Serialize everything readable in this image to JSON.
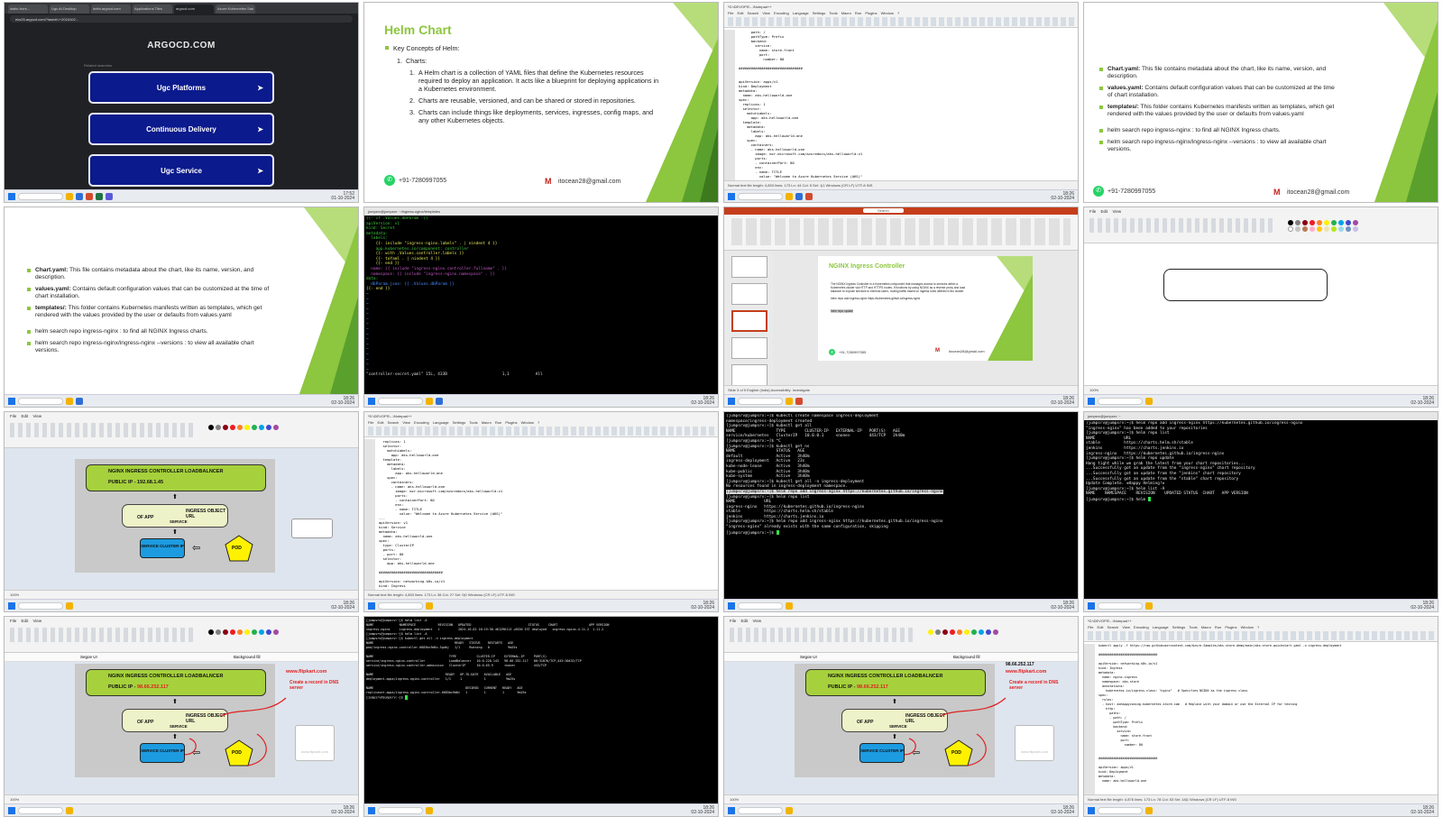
{
  "accent": "#8dc63f",
  "tiles": {
    "t1": {
      "tabs": [
        "static-front...",
        "Ugc At Desktop",
        "delta.argocd.com",
        "Applications Tiles",
        "argocd.com",
        "Azure Kubernetes Sab"
      ],
      "url": "eks25.argocd.com/?lastvtf=+2024102...",
      "logo": "ARGOCD.COM",
      "sub": "Related searches",
      "buttons": [
        "Ugc Platforms",
        "Continuous Delivery",
        "Ugc Service"
      ],
      "clock": [
        "17:52",
        "01-10-2024"
      ]
    },
    "t2": {
      "title": "Helm Chart",
      "bullet1": "Key Concepts of Helm:",
      "n1": "Charts:",
      "items": [
        "A Helm chart is a collection of YAML files that define the Kubernetes resources required to deploy an application. It acts like a blueprint for deploying applications in a Kubernetes environment.",
        "Charts are reusable, versioned, and can be shared or stored in repositories.",
        "Charts can include things like deployments, services, ingresses, config maps, and any other Kubernetes objects."
      ],
      "phone": "+91-7280997055",
      "email": "itocean28@gmail.com"
    },
    "t3": {
      "title": "*D:\\DEVOPS\\...\\Notepad++",
      "menu": "File Edit Search View Encoding Language Settings Tools Macro Run Plugins Window ?",
      "code": "      path: /\n      pathType: Prefix\n      backend:\n        service:\n          name: store-front\n          port:\n            number: 80\n\n###############################\n\n\napiVersion: apps/v1\nkind: Deployment\nmetadata:\n  name: aks-helloworld-one\nspec:\n  replicas: 1\n  selector:\n    matchLabels:\n      app: aks-helloworld-one\n  template:\n    metadata:\n      labels:\n        app: aks-helloworld-one\n    spec:\n      containers:\n      - name: aks-helloworld-one\n        image: mcr.microsoft.com/azuredocs/aks-helloworld:v1\n        ports:\n        - containerPort: 80\n        env:\n        - name: TITLE\n          value: \"Welcome to Azure Kubernetes Service (AKS)\"",
      "status": "Normal text file     length: 4,853  lines: 173     Ln: 44  Col: 5  Sel: 1|1     Windows (CR LF)  UTF-8  INS"
    },
    "t4": {
      "items": [
        [
          "Chart.yaml:",
          " This file contains metadata about the chart, like its name, version, and description."
        ],
        [
          "values.yaml:",
          " Contains default configuration values that can be customized at the time of chart installation."
        ],
        [
          "templates/:",
          " This folder contains Kubernetes manifests written as templates, which get rendered with the values provided by the user or defaults from values.yaml"
        ]
      ],
      "cmds": [
        "helm search repo ingress-nginx : to find all NGINX Ingress charts.",
        "helm search repo ingress-nginx/ingress-nginx --versions : to view all available chart versions."
      ],
      "phone": "+91-7280997055",
      "email": "itocean28@gmail.com"
    },
    "t6": {
      "lines": [
        "{{- if .Values.dbParam -}}",
        "apiVersion: v1",
        "kind: Secret",
        "metadata:",
        "  labels:",
        "    {{- include \"ingress-nginx.labels\" . | nindent 4 }}",
        "    app.kubernetes.io/component: controller",
        "    {{- with .Values.controller.labels }}",
        "    {{- toYaml . | nindent 4 }}",
        "    {{- end }}",
        "  name: {{ include \"ingress-nginx.controller.fullname\" . }}",
        "  namespace: {{ include \"ingress-nginx.namespace\" . }}",
        "data:",
        "  dbParam.json: {{ .Values.dbParam }}",
        "{{- end }}"
      ],
      "status": "\"controller-secret.yaml\" 15L, 433B",
      "pos": "1,1",
      "all": "All"
    },
    "t7": {
      "search": "Search",
      "title": "NGINX Ingress Controller",
      "body": "The NGINX Ingress Controller is a Kubernetes component that manages access to services within a Kubernetes cluster via HTTP and HTTPS routes. It functions by using NGINX as a reverse proxy and load balancer to expose services to external users, routing traffic based on ingress rules defined in the cluster.",
      "cmd1": "helm repo add ingress-nginx https://kubernetes.github.io/ingress-nginx",
      "cmd2": "helm repo update",
      "phone": "+91-7280997055",
      "email": "itocean28@gmail.com",
      "status": "Slide 3 of 5   English (India)   Accessibility: Investigate"
    },
    "t8": {
      "menu": "File  Edit  View",
      "status": "100%"
    },
    "t9": {
      "menu": "File  Edit  View",
      "lb": "NGINX INGRESS CONTROLLER LOADBALNCER",
      "ip": "PUBLIC IP - 192.68.1.45",
      "obj": "INGRESS OBJECT URL",
      "ofapp": "OF APP",
      "service": "SERVICE",
      "svc": "SERVICE CLUSTER IP",
      "pod": "POD",
      "status": "100%"
    },
    "t10": {
      "title": "*D:\\DEVOPS\\...\\Notepad++",
      "code": "  replicas: 1\n  selector:\n    matchLabels:\n      app: aks-helloworld-one\n  template:\n    metadata:\n      labels:\n        app: aks-helloworld-one\n    spec:\n      containers:\n      - name: aks-helloworld-one\n        image: mcr.microsoft.com/azuredocs/aks-helloworld:v1\n        ports:\n        - containerPort: 80\n        env:\n        - name: TITLE\n          value: \"Welcome to Azure Kubernetes Service (AKS)\"\n---\napiVersion: v1\nkind: Service\nmetadata:\n  name: aks-helloworld-one\nspec:\n  type: ClusterIP\n  ports:\n  - port: 80\n  selector:\n    app: aks-helloworld-one\n\n###############################\n\napiVersion: networking.k8s.io/v1\nkind: Ingress\nmetadata:",
      "status": "Normal text file     length: 4,853  lines: 173     Ln: 38  Col: 27  Sel: 0|0     Windows (CR LF)  UTF-8  INS"
    },
    "t11": {
      "lines": [
        "[jumpsrv@jumpsrv:~]$ kubectl create namespace ingress-deployment",
        "namespace/ingress-deployment created",
        "[jumpsrv@jumpsrv:~]$ kubectl get all",
        "NAME                 TYPE        CLUSTER-IP   EXTERNAL-IP   PORT(S)   AGE",
        "service/kubernetes   ClusterIP   10.0.0.1     <none>        443/TCP   3h40m",
        "[jumpsrv@jumpsrv:~]$ ^C",
        "[jumpsrv@jumpsrv:~]$ kubectl get ns",
        "NAME                 STATUS   AGE",
        "default              Active   3h40m",
        "ingress-deployment   Active   23s",
        "kube-node-lease      Active   3h40m",
        "kube-public          Active   3h40m",
        "kube-system          Active   3h40m",
        "[jumpsrv@jumpsrv:~]$ kubectl get all -n ingress-deployment",
        "No resources found in ingress-deployment namespace.",
        "[jumpsrv@jumpsrv:~]$ helm repo add ingress-nginx https://kubernetes.github.io/ingress-nginx",
        "[jumpsrv@jumpsrv:~]$ helm repo list",
        "NAME            URL",
        "ingress-nginx   https://kubernetes.github.io/ingress-nginx",
        "stable          https://charts.helm.sh/stable",
        "jenkins         https://charts.jenkins.io",
        "[jumpsrv@jumpsrv:~]$ helm repo add ingress-nginx https://kubernetes.github.io/ingress-nginx",
        "\"ingress-nginx\" already exists with the same configuration, skipping",
        "[jumpsrv@jumpsrv:~]$ "
      ]
    },
    "t12": {
      "lines": [
        "[jumpsrv@jumpsrv:~]$ helm repo add ingress-nginx https://kubernetes.github.io/ingress-nginx",
        "\"ingress-nginx\" has been added to your repositories",
        "[jumpsrv@jumpsrv:~]$ helm repo list",
        "NAME            URL",
        "stable          https://charts.helm.sh/stable",
        "jenkins         https://charts.jenkins.io",
        "ingress-nginx   https://kubernetes.github.io/ingress-nginx",
        "[jumpsrv@jumpsrv:~]$ helm repo update",
        "Hang tight while we grab the latest from your chart repositories...",
        "...Successfully got an update from the \"ingress-nginx\" chart repository",
        "...Successfully got an update from the \"jenkins\" chart repository",
        "...Successfully got an update from the \"stable\" chart repository",
        "Update Complete. ⎈Happy Helming!⎈",
        "[jumpsrv@jumpsrv:~]$ helm list -A",
        "NAME    NAMESPACE    REVISION    UPDATED STATUS  CHART   APP VERSION",
        "[jumpsrv@jumpsrv:~]$ helm "
      ]
    },
    "t13": {
      "menu": "File  Edit  View",
      "font": "Segoe UI",
      "bgfill": "Background fill",
      "lb": "NGINX INGRESS CONTROLLER LOADBALNCER",
      "ip_label": "PUBLIC IP -",
      "ip": "98.66.252.117",
      "obj": "INGRESS OBJECT URL",
      "ofapp": "OF APP",
      "service": "SERVICE",
      "svc": "SERVICE CLUSTER IP",
      "pod": "POD",
      "site": "www.flipkart.com",
      "note": "Create a record in DNS server",
      "site2": "www.flipkart.com",
      "status": "100%"
    },
    "t14": {
      "lines": [
        "[jumpsrv@jumpsrv:~]$ helm list -A",
        "NAME              NAMESPACE            REVISION   UPDATED                               STATUS     CHART                 APP VERSION",
        "ingress-nginx     ingress-deployment   1          2024-10-02 16:19:50.461296113 +0530 IST deployed   ingress-nginx-4.11.2  1.11.2",
        "[jumpsrv@jumpsrv:~]$ helm list -A",
        "[jumpsrv@jumpsrv:~]$ kubectl get all -n ingress-deployment",
        "NAME                                            READY   STATUS    RESTARTS   AGE",
        "pod/ingress-nginx-controller-6685bc9d6c-5gdbj   1/1     Running   0          9m25s",
        "",
        "NAME                                         TYPE           CLUSTER-IP     EXTERNAL-IP     PORT(S)",
        "service/ingress-nginx-controller             LoadBalancer   10.0.228.143   98.66.252.117   80:31876/TCP,443:30432/TCP",
        "service/ingress-nginx-controller-admission   ClusterIP      10.0.65.9      <none>          443/TCP",
        "",
        "NAME                                       READY   UP-TO-DATE   AVAILABLE   AGE",
        "deployment.apps/ingress-nginx-controller   1/1     1            1           9m25s",
        "",
        "NAME                                                  DESIRED   CURRENT   READY   AGE",
        "replicaset.apps/ingress-nginx-controller-6685bc9d6c   1         1         1       9m25s",
        "[jumpsrv@jumpsrv:~]$ "
      ]
    },
    "t15": {
      "menu": "File  Edit  View",
      "font": "Segoe UI",
      "bgfill": "Background fill",
      "lb": "NGINX INGRESS CONTROLLER LOADBALNCER",
      "ip_label": "PUBLIC IP -",
      "ip": "98.66.252.117",
      "obj": "INGRESS OBJECT URL",
      "ofapp": "OF APP",
      "service": "SERVICE",
      "svc": "SERVICE CLUSTER IP",
      "pod": "POD",
      "site": "www.flipkart.com",
      "note": "Create a record in DNS server",
      "site2": "www.flipkart.com",
      "ip_top": "98.66.252.117",
      "status": "100%"
    },
    "t16": {
      "title": "*D:\\DEVOPS\\...\\Notepad++",
      "code": "kubectl apply -f https://raw.githubusercontent.com/Azure-Samples/aks-store-demo/main/aks-store-quickstart.yaml -n ingress-deployment\n\n################################\n\napiVersion: networking.k8s.io/v1\nkind: Ingress\nmetadata:\n  name: nginx-ingress\n  namespace: aks-store\n  annotations:\n    kubernetes.io/ingress.class: \"nginx\"   # Specifies NGINX as the ingress class\nspec:\n  rules:\n  - host: aohappyzoning.kubernetes.store.com   # Replace with your domain or use the External IP for testing\n    http:\n      paths:\n      - path: /\n        pathType: Prefix\n        backend:\n          service:\n            name: store-front\n            port:\n              number: 80\n\n\n################################\n\napiVersion: apps/v1\nkind: Deployment\nmetadata:\n  name: aks-helloworld-one",
      "status": "Normal text file     length: 4,876  lines: 173     Ln: 78  Col: 53  Sel: 18|1     Windows (CR LF)  UTF-8  INS"
    },
    "clock": [
      "18:26",
      "02-10-2024"
    ]
  }
}
